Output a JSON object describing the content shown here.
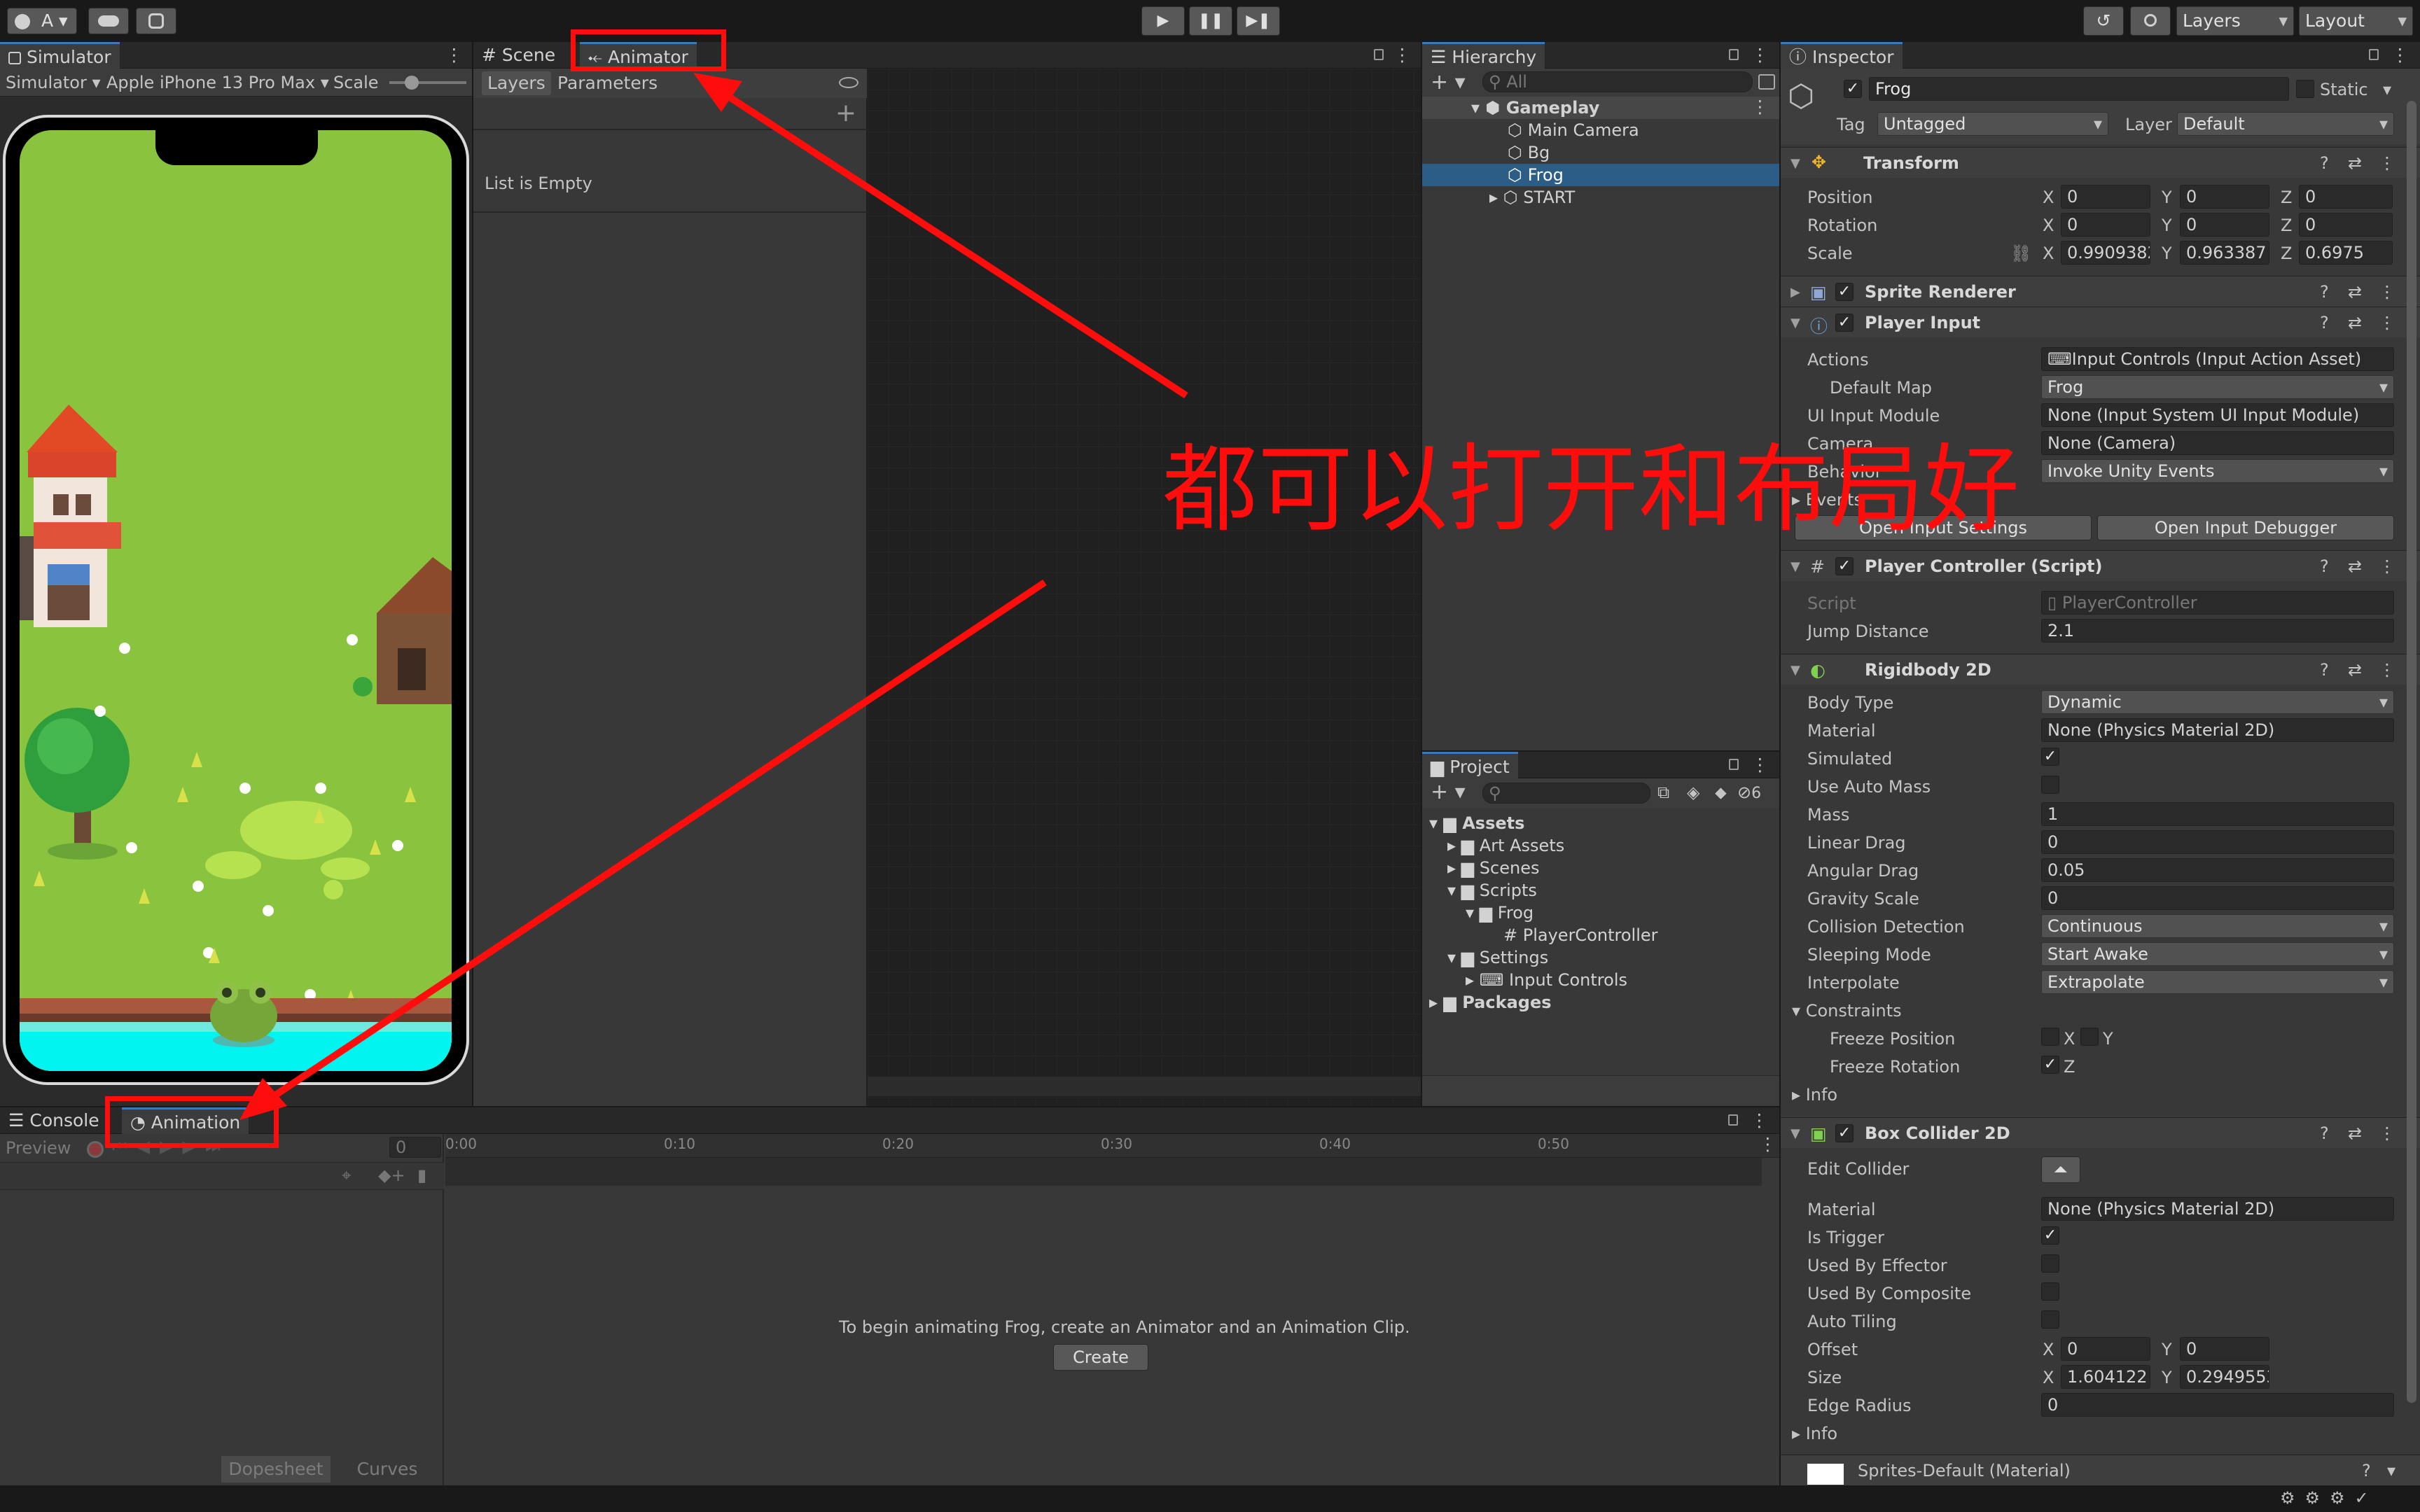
{
  "toolbar": {
    "account": "A",
    "layers": "Layers",
    "layout": "Layout"
  },
  "simulator": {
    "tab": "Simulator",
    "mode": "Simulator",
    "device": "Apple iPhone 13 Pro Max",
    "scale_label": "Scale"
  },
  "scene_tab": "Scene",
  "animator": {
    "tab": "Animator",
    "layers_tab": "Layers",
    "parameters_tab": "Parameters",
    "empty_text": "List is Empty"
  },
  "hierarchy": {
    "tab": "Hierarchy",
    "search_placeholder": "All",
    "items": [
      "Gameplay",
      "Main Camera",
      "Bg",
      "Frog",
      "START"
    ]
  },
  "project": {
    "tab": "Project",
    "count": "6",
    "items": [
      "Assets",
      "Art Assets",
      "Scenes",
      "Scripts",
      "Frog",
      "PlayerController",
      "Settings",
      "Input Controls",
      "Packages"
    ]
  },
  "console_tab": "Console",
  "animation": {
    "tab": "Animation",
    "preview": "Preview",
    "frame": "0",
    "times": [
      "0:00",
      "0:10",
      "0:20",
      "0:30",
      "0:40",
      "0:50"
    ],
    "message": "To begin animating Frog, create an Animator and an Animation Clip.",
    "create": "Create",
    "dopesheet": "Dopesheet",
    "curves": "Curves"
  },
  "inspector": {
    "tab": "Inspector",
    "name": "Frog",
    "static": "Static",
    "tag_label": "Tag",
    "tag": "Untagged",
    "layer_label": "Layer",
    "layer": "Default",
    "transform": {
      "title": "Transform",
      "position": "Position",
      "rotation": "Rotation",
      "scale": "Scale",
      "x": "X",
      "y": "Y",
      "z": "Z",
      "pos": [
        "0",
        "0",
        "0"
      ],
      "rot": [
        "0",
        "0",
        "0"
      ],
      "scl": [
        "0.9909382",
        "0.963387",
        "0.6975"
      ]
    },
    "sprite_renderer": "Sprite Renderer",
    "player_input": {
      "title": "Player Input",
      "actions": "Actions",
      "actions_val": "Input Controls (Input Action Asset)",
      "default_map": "Default Map",
      "default_map_val": "Frog",
      "ui_module": "UI Input Module",
      "ui_module_val": "None (Input System UI Input Module)",
      "camera": "Camera",
      "camera_val": "None (Camera)",
      "behavior": "Behavior",
      "behavior_val": "Invoke Unity Events",
      "events": "Events",
      "open_settings": "Open Input Settings",
      "open_debugger": "Open Input Debugger"
    },
    "player_controller": {
      "title": "Player Controller (Script)",
      "script": "Script",
      "script_val": "PlayerController",
      "jump": "Jump Distance",
      "jump_val": "2.1"
    },
    "rigidbody": {
      "title": "Rigidbody 2D",
      "body_type": "Body Type",
      "body_type_val": "Dynamic",
      "material": "Material",
      "material_val": "None (Physics Material 2D)",
      "simulated": "Simulated",
      "auto_mass": "Use Auto Mass",
      "mass": "Mass",
      "mass_val": "1",
      "linear_drag": "Linear Drag",
      "linear_drag_val": "0",
      "angular_drag": "Angular Drag",
      "angular_drag_val": "0.05",
      "gravity": "Gravity Scale",
      "gravity_val": "0",
      "collision": "Collision Detection",
      "collision_val": "Continuous",
      "sleeping": "Sleeping Mode",
      "sleeping_val": "Start Awake",
      "interpolate": "Interpolate",
      "interpolate_val": "Extrapolate",
      "constraints": "Constraints",
      "freeze_pos": "Freeze Position",
      "freeze_rot": "Freeze Rotation",
      "x": "X",
      "y": "Y",
      "z": "Z",
      "info": "Info"
    },
    "box_collider": {
      "title": "Box Collider 2D",
      "edit": "Edit Collider",
      "material": "Material",
      "material_val": "None (Physics Material 2D)",
      "is_trigger": "Is Trigger",
      "effector": "Used By Effector",
      "composite": "Used By Composite",
      "auto_tiling": "Auto Tiling",
      "offset": "Offset",
      "offset_x": "0",
      "offset_y": "0",
      "size": "Size",
      "size_x": "1.604122",
      "size_y": "0.2949553",
      "edge_radius": "Edge Radius",
      "edge_radius_val": "0",
      "info": "Info"
    },
    "material_row": "Sprites-Default (Material)"
  },
  "annotation": {
    "text": "都可以打开和布局好",
    "color": "#ff0d0d"
  }
}
